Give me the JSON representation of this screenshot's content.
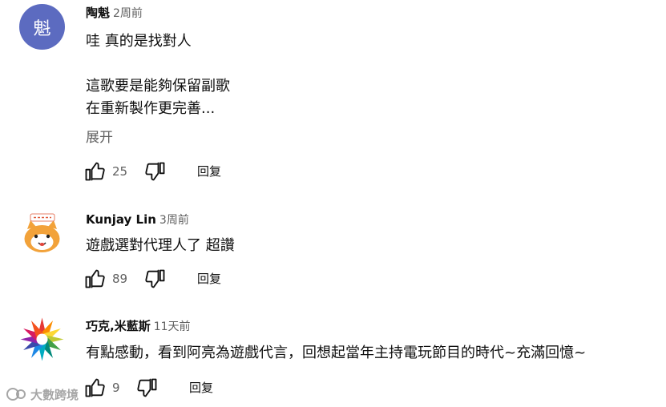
{
  "comments": [
    {
      "author": "陶魁",
      "time": "2周前",
      "avatar_letter": "魁",
      "avatar_color": "#5c6bc0",
      "lines": [
        "哇 真的是找對人",
        "",
        "這歌要是能夠保留副歌",
        "在重新製作更完善..."
      ],
      "expand_label": "展开",
      "likes": "25",
      "reply_label": "回复"
    },
    {
      "author": "Kunjay Lin",
      "time": "3周前",
      "avatar_icon": "cat-avatar-icon",
      "lines": [
        "遊戲選對代理人了 超讚"
      ],
      "likes": "89",
      "reply_label": "回复"
    },
    {
      "author": "巧克,米藍斯",
      "time": "11天前",
      "avatar_icon": "rainbow-star-avatar-icon",
      "lines": [
        "有點感動，看到阿亮為遊戲代言，回想起當年主持電玩節目的時代~充滿回憶~"
      ],
      "likes": "9",
      "reply_label": "回复"
    }
  ],
  "watermark": {
    "text": "大數跨境",
    "icon": "watermark-logo-icon"
  }
}
